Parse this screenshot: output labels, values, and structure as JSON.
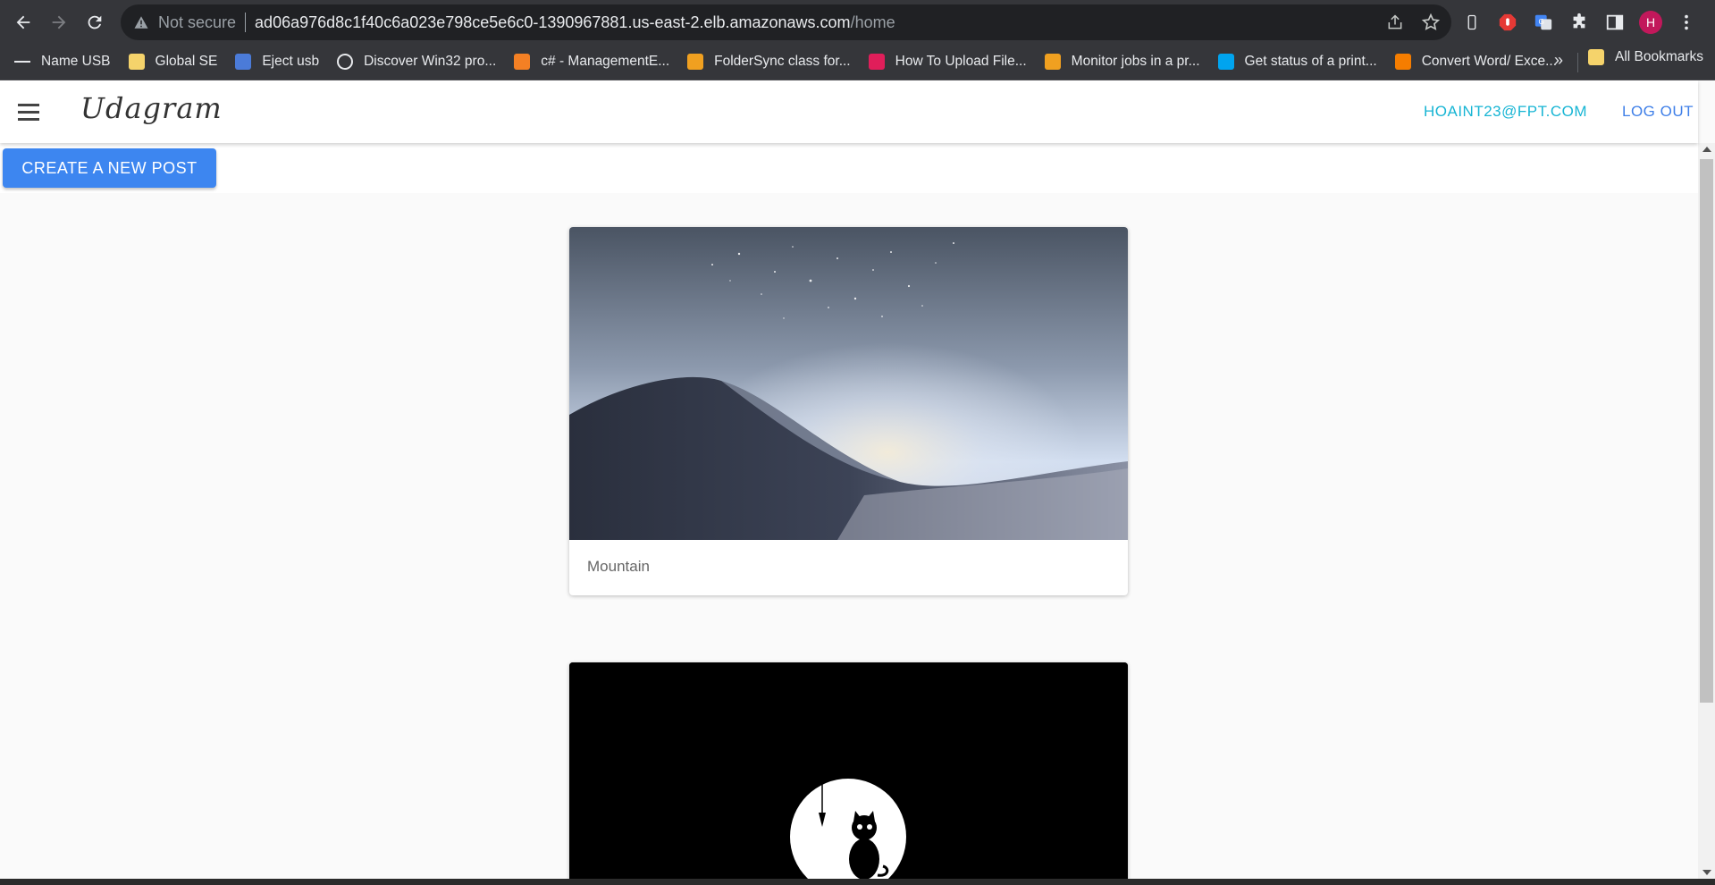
{
  "browser": {
    "security_label": "Not secure",
    "url_host": "ad06a976d8c1f40c6a023e798ce5e6c0-1390967881.us-east-2.elb.amazonaws.com",
    "url_path": "/home",
    "profile_initial": "H",
    "bookmarks": [
      {
        "label": "Name USB",
        "icon": "dash-icon",
        "color": "#e8eaed"
      },
      {
        "label": "Global SE",
        "icon": "folder-icon",
        "color": "#f5d36b"
      },
      {
        "label": "Eject usb",
        "icon": "usb-icon",
        "color": "#4b7bd8"
      },
      {
        "label": "Discover Win32 pro...",
        "icon": "github-icon",
        "color": "#e8eaed"
      },
      {
        "label": "c# - ManagementE...",
        "icon": "stackoverflow-icon",
        "color": "#f48024"
      },
      {
        "label": "FolderSync class for...",
        "icon": "site-icon",
        "color": "#f0a020"
      },
      {
        "label": "How To Upload File...",
        "icon": "slack-icon",
        "color": "#e01e5a"
      },
      {
        "label": "Monitor jobs in a pr...",
        "icon": "site-icon",
        "color": "#f0a020"
      },
      {
        "label": "Get status of a print...",
        "icon": "microsoft-icon",
        "color": "#00a4ef"
      },
      {
        "label": "Convert Word/ Exce...",
        "icon": "blogger-icon",
        "color": "#f57d00"
      }
    ],
    "more_label": "»",
    "all_bookmarks_label": "All Bookmarks"
  },
  "app": {
    "brand": "Udagram",
    "user_email": "HOAINT23@FPT.COM",
    "logout_label": "LOG OUT",
    "create_post_label": "CREATE A NEW POST"
  },
  "feed": [
    {
      "caption": "Mountain",
      "image": "mountain-dune-landscape"
    },
    {
      "caption": "",
      "image": "cat-fishing-moon"
    }
  ]
}
